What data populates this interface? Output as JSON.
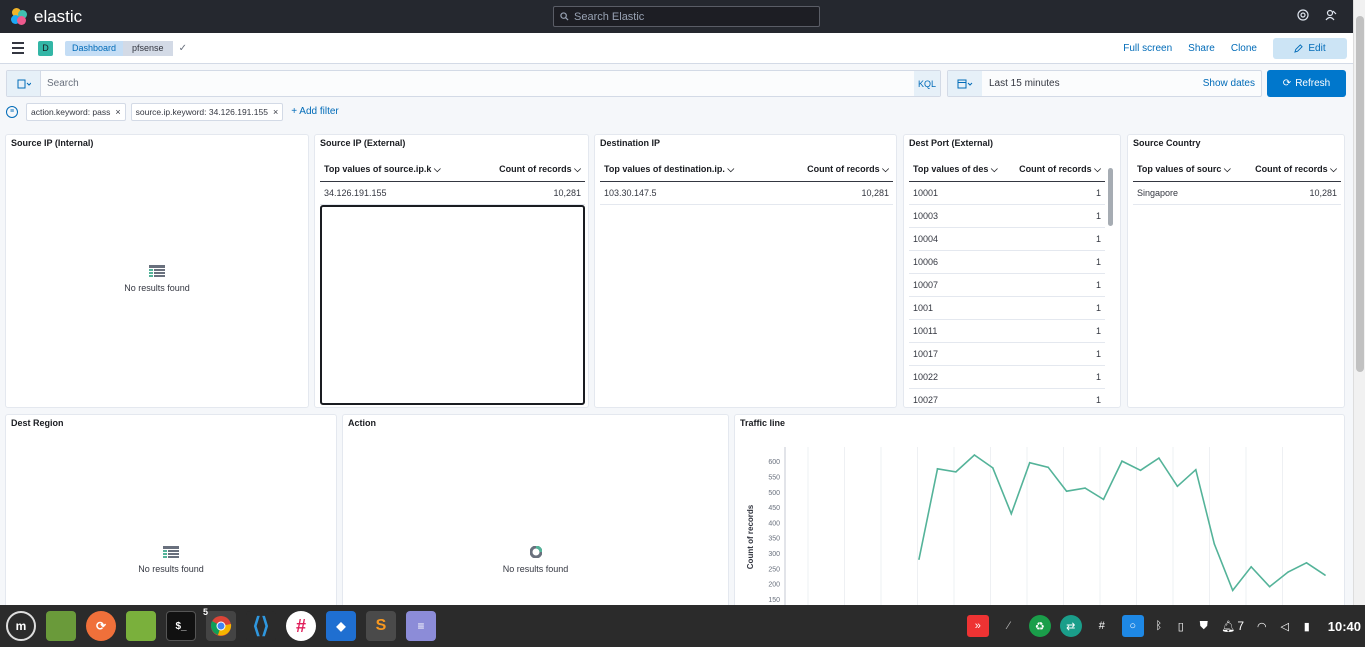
{
  "header": {
    "app_name": "elastic",
    "search_placeholder": "Search Elastic"
  },
  "breadcrumbs": {
    "space": "D",
    "items": [
      "Dashboard",
      "pfsense"
    ]
  },
  "nav_actions": {
    "full_screen": "Full screen",
    "share": "Share",
    "clone": "Clone",
    "edit": "Edit"
  },
  "query": {
    "placeholder": "Search",
    "language": "KQL",
    "time_range": "Last 15 minutes",
    "show_dates": "Show dates",
    "refresh": "Refresh"
  },
  "filters": {
    "pills": [
      "action.keyword: pass",
      "source.ip.keyword: 34.126.191.155"
    ],
    "add_filter": "+ Add filter"
  },
  "panels": {
    "source_ip_internal": {
      "title": "Source IP (Internal)",
      "empty": "No results found"
    },
    "source_ip_external": {
      "title": "Source IP (External)",
      "col1": "Top values of source.ip.k",
      "col2": "Count of records",
      "rows": [
        {
          "key": "34.126.191.155",
          "count": "10,281"
        }
      ]
    },
    "destination_ip": {
      "title": "Destination IP",
      "col1": "Top values of destination.ip.",
      "col2": "Count of records",
      "rows": [
        {
          "key": "103.30.147.5",
          "count": "10,281"
        }
      ]
    },
    "dest_port": {
      "title": "Dest Port (External)",
      "col1": "Top values of des",
      "col2": "Count of records",
      "rows": [
        {
          "key": "10001",
          "count": "1"
        },
        {
          "key": "10003",
          "count": "1"
        },
        {
          "key": "10004",
          "count": "1"
        },
        {
          "key": "10006",
          "count": "1"
        },
        {
          "key": "10007",
          "count": "1"
        },
        {
          "key": "1001",
          "count": "1"
        },
        {
          "key": "10011",
          "count": "1"
        },
        {
          "key": "10017",
          "count": "1"
        },
        {
          "key": "10022",
          "count": "1"
        },
        {
          "key": "10027",
          "count": "1"
        }
      ]
    },
    "source_country": {
      "title": "Source Country",
      "col1": "Top values of sourc",
      "col2": "Count of records",
      "rows": [
        {
          "key": "Singapore",
          "count": "10,281"
        }
      ]
    },
    "dest_region": {
      "title": "Dest Region",
      "empty": "No results found"
    },
    "action": {
      "title": "Action",
      "empty": "No results found"
    },
    "traffic_line": {
      "title": "Traffic line"
    }
  },
  "chart_data": {
    "type": "line",
    "title": "Traffic line",
    "ylabel": "Count of records",
    "ylim": [
      150,
      620
    ],
    "yticks": [
      150,
      200,
      250,
      300,
      350,
      400,
      450,
      500,
      550,
      600
    ],
    "series": [
      {
        "color": "#54b399",
        "values": [
          280,
          575,
          565,
          620,
          578,
          428,
          595,
          580,
          502,
          512,
          475,
          600,
          570,
          610,
          518,
          572,
          330,
          178,
          255,
          190,
          238,
          268,
          228
        ]
      }
    ]
  },
  "taskbar": {
    "apps": [
      "mint-menu",
      "file-manager",
      "firefox",
      "folder",
      "terminal",
      "chrome",
      "vscode",
      "slack",
      "app-layers",
      "sublime",
      "text-editor"
    ],
    "chrome_badge": "5",
    "notification_count": "7",
    "clock": "10:40"
  },
  "colors": {
    "header_bg": "#25282f",
    "accent": "#0077cc",
    "line": "#54b399"
  }
}
